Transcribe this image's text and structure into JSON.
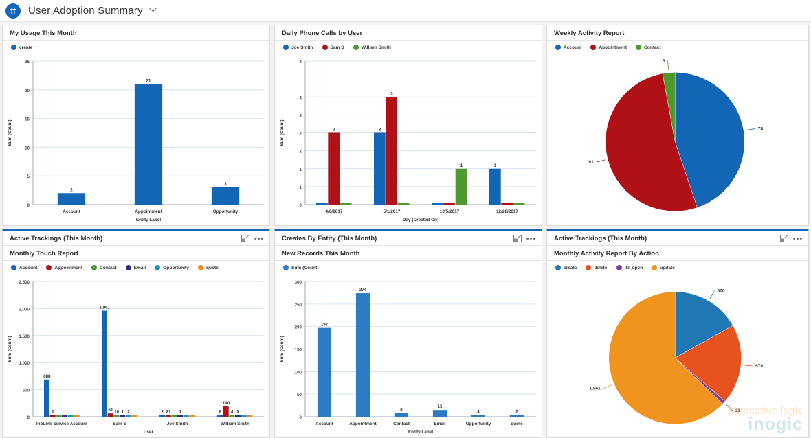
{
  "appbar": {
    "logo_icon": "grid-app-icon",
    "title": "User Adoption Summary",
    "chevron_icon": "chevron-down-icon"
  },
  "tiles": [
    {
      "header": "",
      "sub_header": "My Usage This Month",
      "has_header_icons": false
    },
    {
      "header": "",
      "sub_header": "Daily Phone Calls by User",
      "has_header_icons": false
    },
    {
      "header": "",
      "sub_header": "Weekly Activity Report",
      "has_header_icons": false
    },
    {
      "header": "Active Trackings (This Month)",
      "sub_header": "Monthly Touch Report",
      "has_header_icons": true
    },
    {
      "header": "Creates By Entity (This Month)",
      "sub_header": "New Records This Month",
      "has_header_icons": true
    },
    {
      "header": "Active Trackings (This Month)",
      "sub_header": "Monthly Activity Report By Action",
      "has_header_icons": true
    }
  ],
  "header_icons": {
    "expand_icon": "expand-chart-icon",
    "more_icon": "more-options-icon",
    "more_glyph": "•••"
  },
  "watermark": {
    "line1": "innovative logic",
    "line2": "inogic"
  },
  "colors": {
    "blue": "#1266b5",
    "red": "#b01116",
    "green": "#4e9a2f",
    "navy": "#2d2d83",
    "teal": "#1898c0",
    "orange": "#ef8a23",
    "pie_blue": "#1f77b4",
    "pie_orange": "#f0941f",
    "pie_red_orange": "#e8521e",
    "pie_purple": "#7b3fa0",
    "grid": "#d6e3f0",
    "axis": "#999999",
    "text": "#333333"
  },
  "chart_data": [
    {
      "id": "my-usage-this-month",
      "type": "bar",
      "title": "My Usage This Month",
      "legend": [
        {
          "name": "create",
          "color": "#1266b5"
        }
      ],
      "categories": [
        "Account",
        "Appointment",
        "Opportunity"
      ],
      "series": [
        {
          "name": "create",
          "color": "#1266b5",
          "values": [
            2,
            21,
            3
          ]
        }
      ],
      "value_labels": [
        "2",
        "21",
        "3"
      ],
      "xlabel": "Entity Label",
      "ylabel": "Sum (Count)",
      "ylim": [
        0,
        25
      ],
      "yticks": [
        "0",
        "5",
        "10",
        "15",
        "20",
        "25"
      ],
      "ytick_values": [
        0,
        5,
        10,
        15,
        20,
        25
      ],
      "grid": true,
      "legend_position": "top-left"
    },
    {
      "id": "daily-phone-calls-by-user",
      "type": "bar",
      "title": "Daily Phone Calls by User",
      "legend": [
        {
          "name": "Joe Smith",
          "color": "#1266b5"
        },
        {
          "name": "Sam S",
          "color": "#b01116"
        },
        {
          "name": "William Smith",
          "color": "#4e9a2f"
        }
      ],
      "categories": [
        "4/6/2017",
        "5/1/2017",
        "10/5/2017",
        "12/28/2017"
      ],
      "series": [
        {
          "name": "Joe Smith",
          "color": "#1266b5",
          "values": [
            0,
            2,
            0,
            1
          ]
        },
        {
          "name": "Sam S",
          "color": "#b01116",
          "values": [
            2,
            3,
            0,
            0
          ]
        },
        {
          "name": "William Smith",
          "color": "#4e9a2f",
          "values": [
            0,
            0,
            1,
            0
          ]
        }
      ],
      "value_labels": [
        [
          "",
          "2",
          ""
        ],
        [
          "2",
          "3",
          ""
        ],
        [
          "",
          "",
          "1"
        ],
        [
          "1",
          "",
          ""
        ]
      ],
      "xlabel": "Day (Created On)",
      "ylabel": "Sum (Count)",
      "ylim": [
        0,
        4
      ],
      "yticks": [
        "0",
        "1",
        "1",
        "2",
        "2",
        "3",
        "3",
        "4"
      ],
      "ytick_values": [
        0,
        0.5,
        1,
        1.5,
        2,
        2.5,
        3,
        4
      ],
      "grid": true,
      "legend_position": "top-left"
    },
    {
      "id": "weekly-activity-report",
      "type": "pie",
      "title": "Weekly Activity Report",
      "legend": [
        {
          "name": "Account",
          "color": "#1266b5"
        },
        {
          "name": "Appointment",
          "color": "#b01116"
        },
        {
          "name": "Contact",
          "color": "#4e9a2f"
        }
      ],
      "labels": [
        "Account",
        "Appointment",
        "Contact"
      ],
      "values": [
        78,
        91,
        5
      ],
      "value_labels": [
        "78",
        "91",
        "5"
      ],
      "colors": [
        "#1266b5",
        "#b01116",
        "#4e9a2f"
      ],
      "legend_position": "top-left"
    },
    {
      "id": "monthly-touch-report",
      "type": "bar",
      "title": "Monthly Touch Report",
      "legend": [
        {
          "name": "Account",
          "color": "#1266b5"
        },
        {
          "name": "Appointment",
          "color": "#b01116"
        },
        {
          "name": "Contact",
          "color": "#4e9a2f"
        },
        {
          "name": "Email",
          "color": "#2d2d83"
        },
        {
          "name": "Opportunity",
          "color": "#1898c0"
        },
        {
          "name": "quote",
          "color": "#ef8a23"
        }
      ],
      "categories": [
        "InoLink Service Account",
        "Sam S",
        "Joe Smith",
        "William Smith"
      ],
      "series": [
        {
          "name": "Account",
          "color": "#1266b5",
          "values": [
            688,
            1961,
            2,
            8
          ]
        },
        {
          "name": "Appointment",
          "color": "#b01116",
          "values": [
            5,
            61,
            21,
            190
          ]
        },
        {
          "name": "Contact",
          "color": "#4e9a2f",
          "values": [
            0,
            10,
            0,
            4
          ]
        },
        {
          "name": "Email",
          "color": "#2d2d83",
          "values": [
            0,
            1,
            1,
            5
          ]
        },
        {
          "name": "Opportunity",
          "color": "#1898c0",
          "values": [
            0,
            2,
            0,
            0
          ]
        },
        {
          "name": "quote",
          "color": "#ef8a23",
          "values": [
            0,
            0,
            0,
            0
          ]
        }
      ],
      "value_labels": [
        [
          "688",
          "5",
          "",
          "",
          "",
          ""
        ],
        [
          "1,961",
          "61",
          "10",
          "1",
          "2",
          ""
        ],
        [
          "2",
          "21",
          "",
          "1",
          "",
          ""
        ],
        [
          "8",
          "190",
          "4",
          "5",
          "",
          ""
        ]
      ],
      "xlabel": "User",
      "ylabel": "Sum (Count)",
      "ylim": [
        0,
        2500
      ],
      "yticks": [
        "0",
        "500",
        "1,000",
        "1,500",
        "2,000",
        "2,500"
      ],
      "ytick_values": [
        0,
        500,
        1000,
        1500,
        2000,
        2500
      ],
      "grid": true,
      "legend_position": "top-left"
    },
    {
      "id": "new-records-this-month",
      "type": "bar",
      "title": "New Records This Month",
      "legend": [
        {
          "name": "Sum (Count)",
          "color": "#2b7cc4"
        }
      ],
      "categories": [
        "Account",
        "Appointment",
        "Contact",
        "Email",
        "Opportunity",
        "quote"
      ],
      "series": [
        {
          "name": "Sum (Count)",
          "color": "#2b7cc4",
          "values": [
            197,
            274,
            8,
            15,
            4,
            2
          ]
        }
      ],
      "value_labels": [
        "197",
        "274",
        "8",
        "15",
        "4",
        "2"
      ],
      "xlabel": "Entity Label",
      "ylabel": "Sum (Count)",
      "ylim": [
        0,
        300
      ],
      "yticks": [
        "0",
        "50",
        "100",
        "150",
        "200",
        "250",
        "300"
      ],
      "ytick_values": [
        0,
        50,
        100,
        150,
        200,
        250,
        300
      ],
      "grid": true,
      "legend_position": "top-left"
    },
    {
      "id": "monthly-activity-report-by-action",
      "type": "pie",
      "title": "Monthly Activity Report By Action",
      "legend": [
        {
          "name": "create",
          "color": "#1f77b4"
        },
        {
          "name": "delete",
          "color": "#e8521e"
        },
        {
          "name": "ikl_open",
          "color": "#7b3fa0"
        },
        {
          "name": "update",
          "color": "#f0941f"
        }
      ],
      "labels": [
        "create",
        "delete",
        "ikl_open",
        "update"
      ],
      "values": [
        500,
        579,
        23,
        1861
      ],
      "value_labels": [
        "500",
        "579",
        "23",
        "1,861"
      ],
      "colors": [
        "#1f77b4",
        "#e8521e",
        "#7b3fa0",
        "#f0941f"
      ],
      "legend_position": "top-left"
    }
  ]
}
